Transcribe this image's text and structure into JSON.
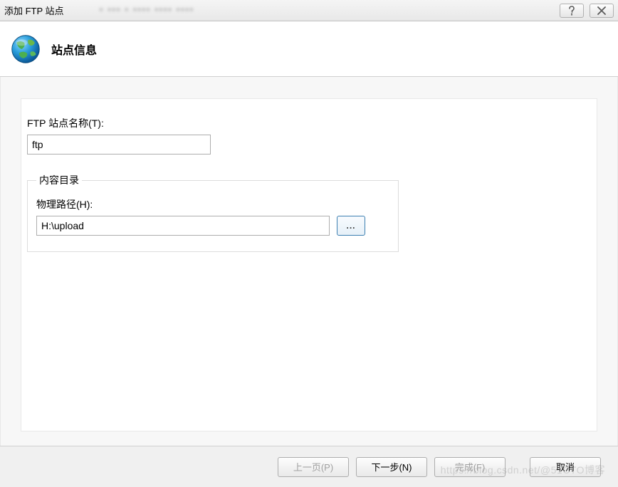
{
  "titlebar": {
    "title": "添加 FTP 站点"
  },
  "header": {
    "heading": "站点信息"
  },
  "form": {
    "site_name_label": "FTP 站点名称(T):",
    "site_name_value": "ftp",
    "content_dir_legend": "内容目录",
    "physical_path_label": "物理路径(H):",
    "physical_path_value": "H:\\upload",
    "browse_label": "..."
  },
  "footer": {
    "previous": "上一页(P)",
    "next": "下一步(N)",
    "finish": "完成(F)",
    "cancel": "取消"
  },
  "watermark": "https://blog.csdn.net/@51CTO博客"
}
